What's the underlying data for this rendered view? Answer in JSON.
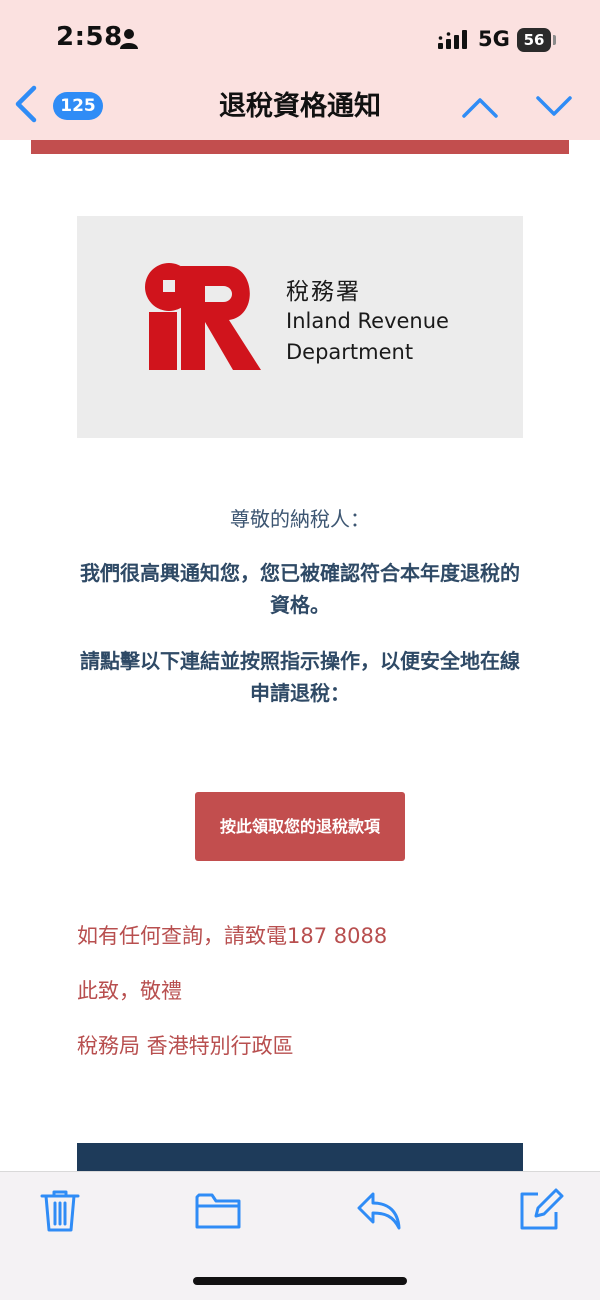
{
  "status_bar": {
    "time": "2:58",
    "network": "5G",
    "battery": "56"
  },
  "nav": {
    "unread_count": "125",
    "title": "退稅資格通知"
  },
  "logo": {
    "zh": "稅務署",
    "en_line1": "Inland Revenue",
    "en_line2": "Department"
  },
  "email": {
    "greeting": "尊敬的納稅人：",
    "para1": "我們很高興通知您，您已被確認符合本年度退稅的資格。",
    "para2": "請點擊以下連結並按照指示操作，以便安全地在線申請退稅：",
    "button_label": "按此領取您的退稅款項",
    "enquiry": "如有任何查詢，請致電187 8088",
    "closing": "此致，敬禮",
    "signature": "稅務局 香港特別行政區"
  },
  "colors": {
    "accent_red": "#c24e4e",
    "header_bg": "#fbe1e0",
    "ios_blue": "#2f8cf6",
    "text_blue": "#2f4a66",
    "band_navy": "#1e3b5a"
  },
  "toolbar": {
    "icons": [
      "trash-icon",
      "folder-icon",
      "reply-icon",
      "compose-icon"
    ]
  }
}
